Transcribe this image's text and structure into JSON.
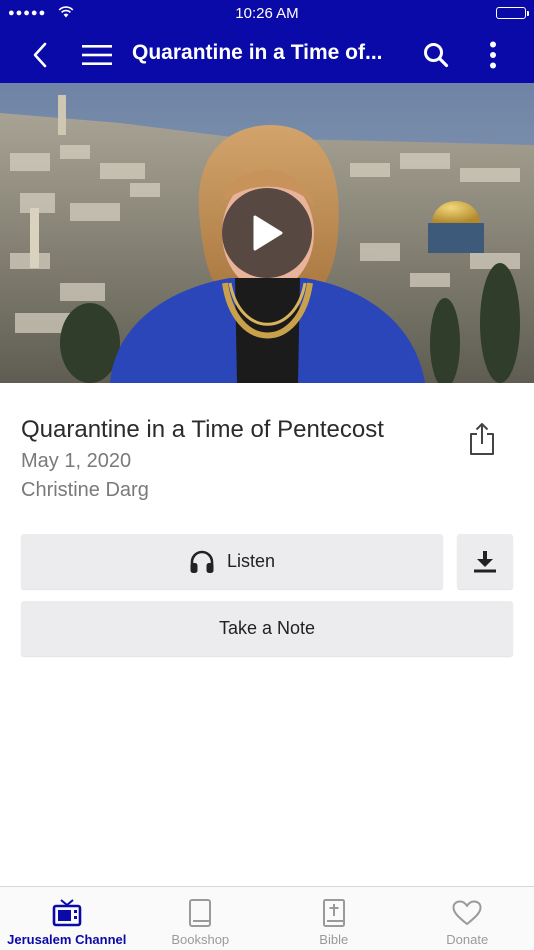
{
  "status_bar": {
    "time": "10:26 AM",
    "signal": "●●●●●"
  },
  "nav": {
    "title": "Quarantine in a Time of...",
    "icons": [
      "back-icon",
      "menu-icon",
      "search-icon",
      "more-vertical-icon"
    ]
  },
  "episode": {
    "title": "Quarantine in a Time of Pentecost",
    "date": "May 1, 2020",
    "author": "Christine Darg"
  },
  "actions": {
    "listen_label": "Listen",
    "note_label": "Take a Note"
  },
  "tabs": [
    {
      "label": "Jerusalem Channel",
      "icon": "tv-icon",
      "active": true
    },
    {
      "label": "Bookshop",
      "icon": "book-icon",
      "active": false
    },
    {
      "label": "Bible",
      "icon": "bible-icon",
      "active": false
    },
    {
      "label": "Donate",
      "icon": "heart-icon",
      "active": false
    }
  ],
  "colors": {
    "brand": "#0a0aa8",
    "button_bg": "#ececee",
    "inactive": "#9a9a9a"
  }
}
